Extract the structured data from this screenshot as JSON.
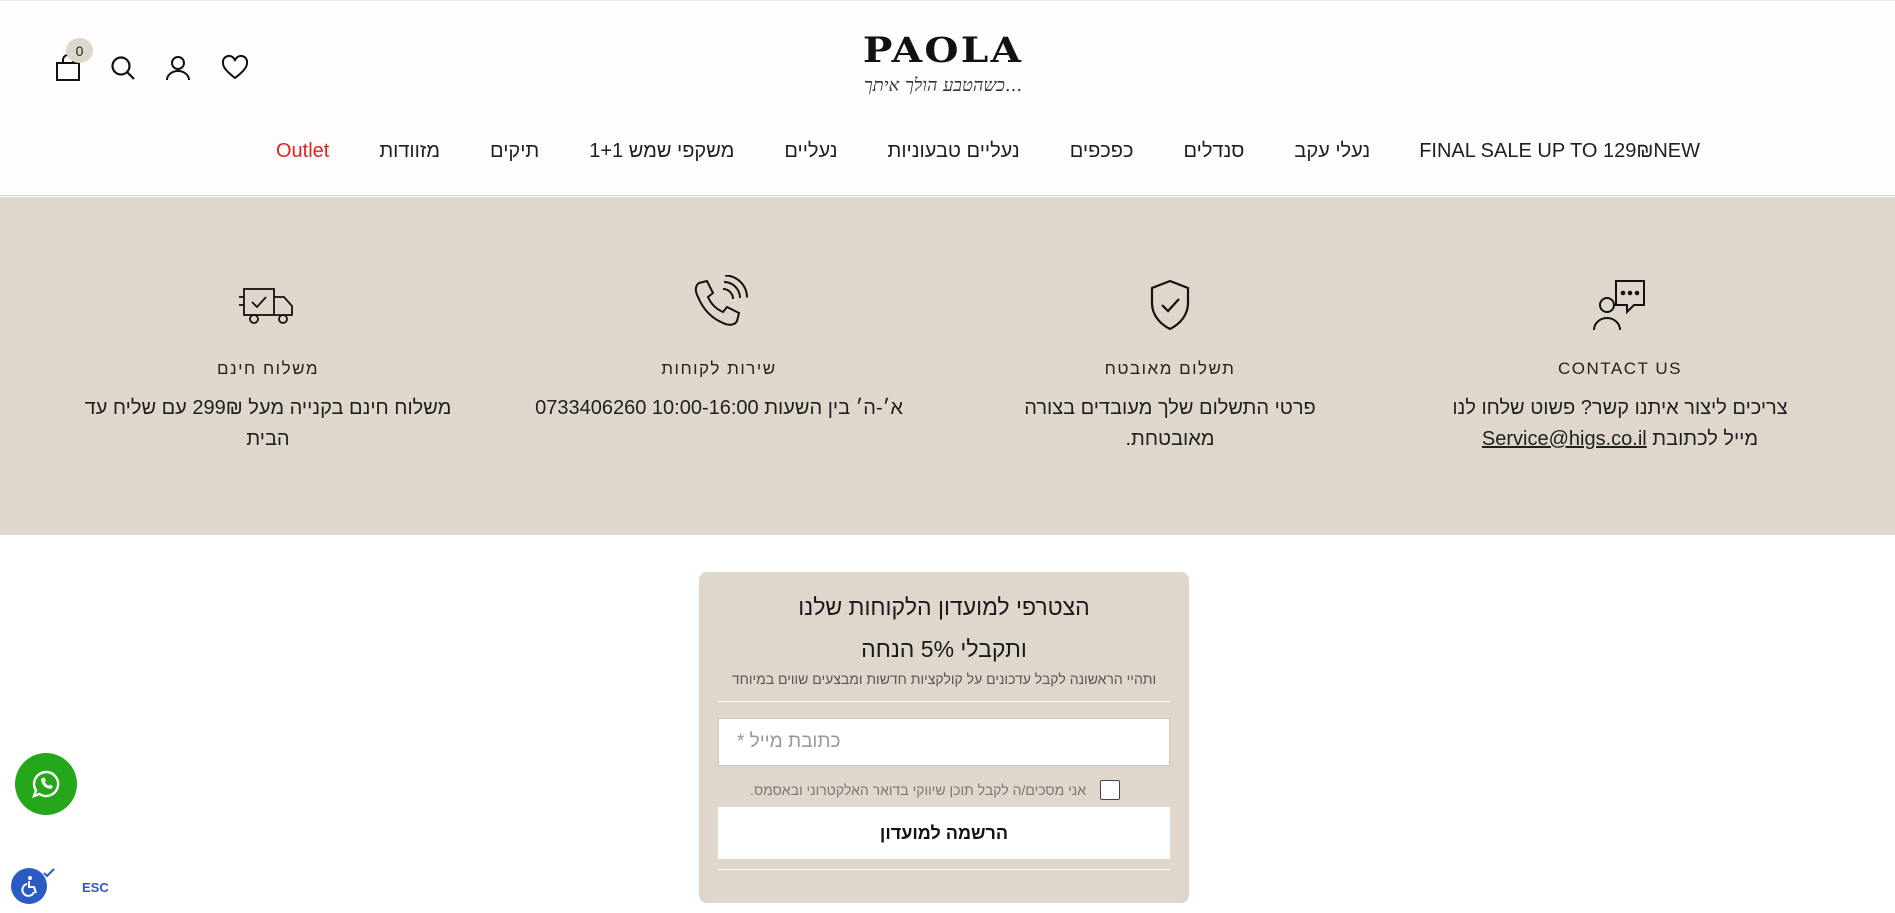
{
  "header": {
    "logo_word": "PAOLA",
    "logo_tagline": "כשהטבע הולך איתך...",
    "cart_count": "0"
  },
  "nav": {
    "items": [
      {
        "label": "NEW"
      },
      {
        "label": "FINAL SALE UP TO 129₪"
      },
      {
        "label": "נעלי עקב"
      },
      {
        "label": "סנדלים"
      },
      {
        "label": "כפכפים"
      },
      {
        "label": "נעליים טבעוניות"
      },
      {
        "label": "נעליים"
      },
      {
        "label": "משקפי שמש 1+1"
      },
      {
        "label": "תיקים"
      },
      {
        "label": "מזוודות"
      },
      {
        "label": "Outlet"
      }
    ],
    "outlet_color": "#e0231c"
  },
  "features": {
    "contact": {
      "title": "CONTACT US",
      "desc": "צריכים ליצור איתנו קשר? פשוט שלחו לנו מייל לכתובת",
      "email": "Service@higs.co.il"
    },
    "secure": {
      "title": "תשלום מאובטח",
      "desc": "פרטי התשלום שלך מעובדים בצורה מאובטחת."
    },
    "service": {
      "title": "שירות לקוחות",
      "desc": "א׳-ה׳ בין השעות 10:00-16:00 0733406260"
    },
    "shipping": {
      "title": "משלוח חינם",
      "desc": "משלוח חינם בקנייה מעל 299₪ עם שליח עד הבית"
    }
  },
  "newsletter": {
    "title_line1": "הצטרפי למועדון הלקוחות שלנו",
    "title_line2": "ותקבלי 5% הנחה",
    "subtitle": "ותהיי הראשונה לקבל עדכונים על קולקציות חדשות ומבצעים שווים במיוחד",
    "email_placeholder": "כתובת מייל *",
    "consent_label": "אני מסכים/ה לקבל תוכן שיווקי בדואר האלקטרוני ובאסמס.",
    "submit_label": "הרשמה למועדון"
  },
  "floating": {
    "esc_label": "ESC"
  },
  "colors": {
    "beige": "#dfd7cb",
    "whatsapp": "#25a71c",
    "accessibility": "#2a5bc4"
  }
}
